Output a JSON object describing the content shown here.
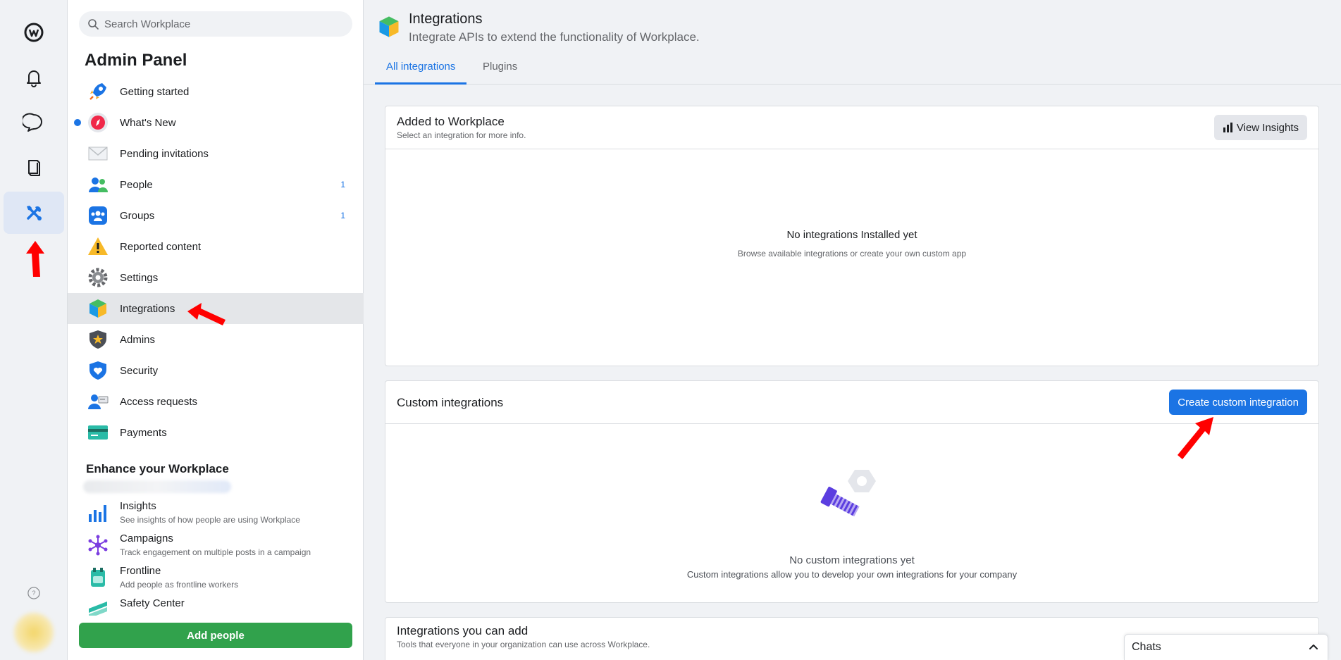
{
  "search": {
    "placeholder": "Search Workplace"
  },
  "sidebar": {
    "title": "Admin Panel",
    "items": [
      {
        "label": "Getting started",
        "icon": "rocket-icon"
      },
      {
        "label": "What's New",
        "icon": "compass-icon",
        "unread_dot": true
      },
      {
        "label": "Pending invitations",
        "icon": "envelope-icon"
      },
      {
        "label": "People",
        "icon": "people-icon",
        "count": "1"
      },
      {
        "label": "Groups",
        "icon": "groups-icon",
        "count": "1"
      },
      {
        "label": "Reported content",
        "icon": "warning-icon"
      },
      {
        "label": "Settings",
        "icon": "gear-icon"
      },
      {
        "label": "Integrations",
        "icon": "cube-icon",
        "active": true
      },
      {
        "label": "Admins",
        "icon": "shield-star-icon"
      },
      {
        "label": "Security",
        "icon": "shield-heart-icon"
      },
      {
        "label": "Access requests",
        "icon": "person-card-icon"
      },
      {
        "label": "Payments",
        "icon": "credit-card-icon"
      }
    ],
    "enhance_title": "Enhance your Workplace",
    "enhance_items": [
      {
        "title": "Insights",
        "subtitle": "See insights of how people are using Workplace",
        "icon": "bar-chart-icon"
      },
      {
        "title": "Campaigns",
        "subtitle": "Track engagement on multiple posts in a campaign",
        "icon": "network-icon"
      },
      {
        "title": "Frontline",
        "subtitle": "Add people as frontline workers",
        "icon": "frontline-icon"
      },
      {
        "title": "Safety Center",
        "subtitle": "",
        "icon": "safety-icon"
      }
    ],
    "add_people": "Add people"
  },
  "header": {
    "title": "Integrations",
    "subtitle": "Integrate APIs to extend the functionality of Workplace.",
    "tabs": [
      {
        "label": "All integrations",
        "active": true
      },
      {
        "label": "Plugins",
        "active": false
      }
    ]
  },
  "added": {
    "title": "Added to Workplace",
    "subtitle": "Select an integration for more info.",
    "button": "View Insights",
    "empty_title": "No integrations Installed yet",
    "empty_sub": "Browse available integrations or create your own custom app"
  },
  "custom": {
    "title": "Custom integrations",
    "button": "Create custom integration",
    "empty_title": "No custom integrations yet",
    "empty_sub": "Custom integrations allow you to develop your own integrations for your company"
  },
  "available": {
    "title": "Integrations you can add",
    "subtitle": "Tools that everyone in your organization can use across Workplace."
  },
  "chats": {
    "label": "Chats"
  },
  "colors": {
    "accent": "#1b74e4",
    "add_button": "#31a24c",
    "annotation_arrow": "#ff0000"
  }
}
